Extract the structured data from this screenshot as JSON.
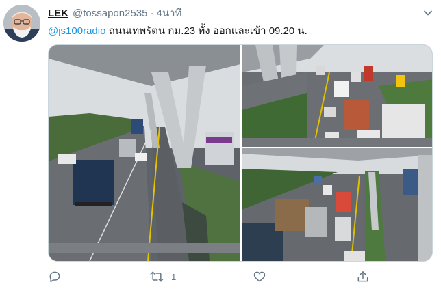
{
  "tweet": {
    "display_name": "LEK",
    "handle": "@tossapon2535",
    "separator": "·",
    "timestamp": "4นาที",
    "mention": "@js100radio",
    "text": " ถนนเทพรัตน กม.23 ทั้ง ออกและเข้า 09.20 น."
  },
  "media": {
    "photos": [
      {
        "name": "highway-traffic-photo-1",
        "subject": "elevated-highway-traffic"
      },
      {
        "name": "highway-traffic-photo-2",
        "subject": "trucks-on-highway"
      },
      {
        "name": "highway-traffic-photo-3",
        "subject": "congested-highway"
      }
    ]
  },
  "actions": {
    "reply_icon": "reply-icon",
    "retweet_icon": "retweet-icon",
    "retweet_count": "1",
    "like_icon": "heart-icon",
    "share_icon": "share-icon"
  },
  "colors": {
    "link": "#1b95e0",
    "secondary_text": "#657786",
    "border": "#ccd6dd"
  }
}
